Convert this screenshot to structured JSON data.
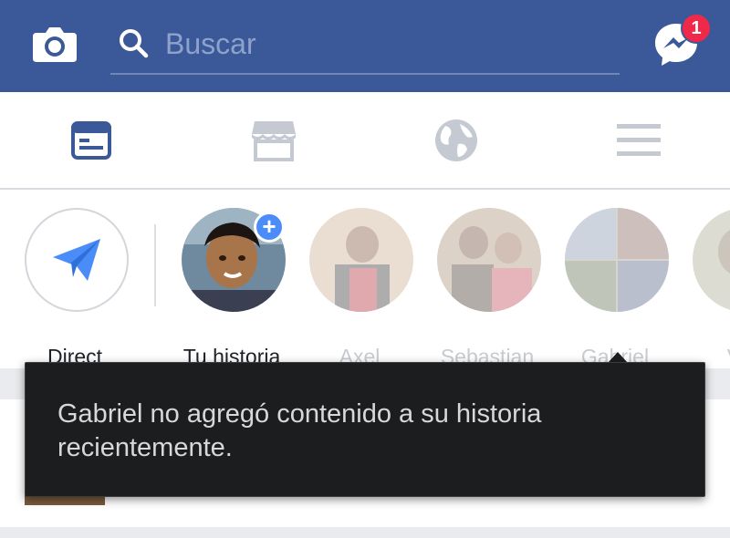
{
  "header": {
    "search_placeholder": "Buscar",
    "messenger_badge": "1",
    "colors": {
      "bar": "#3b5998",
      "badge": "#f02849"
    },
    "icons": [
      "camera-icon",
      "search-icon",
      "messenger-icon"
    ]
  },
  "tabs": [
    {
      "icon": "news-feed-icon",
      "active": true
    },
    {
      "icon": "marketplace-icon",
      "active": false
    },
    {
      "icon": "globe-icon",
      "active": false
    },
    {
      "icon": "menu-icon",
      "active": false
    }
  ],
  "stories": {
    "direct": {
      "label": "Direct",
      "icon": "paper-plane-icon"
    },
    "items": [
      {
        "label": "Tu historia",
        "faded": false,
        "add_icon": "plus-icon"
      },
      {
        "label": "Axel",
        "faded": true
      },
      {
        "label": "Sebastian",
        "faded": true
      },
      {
        "label": "Gabriel",
        "faded": true
      },
      {
        "label": "Ver",
        "faded": true
      }
    ]
  },
  "tooltip": {
    "text": "Gabriel no agregó contenido a su historia recientemente."
  }
}
